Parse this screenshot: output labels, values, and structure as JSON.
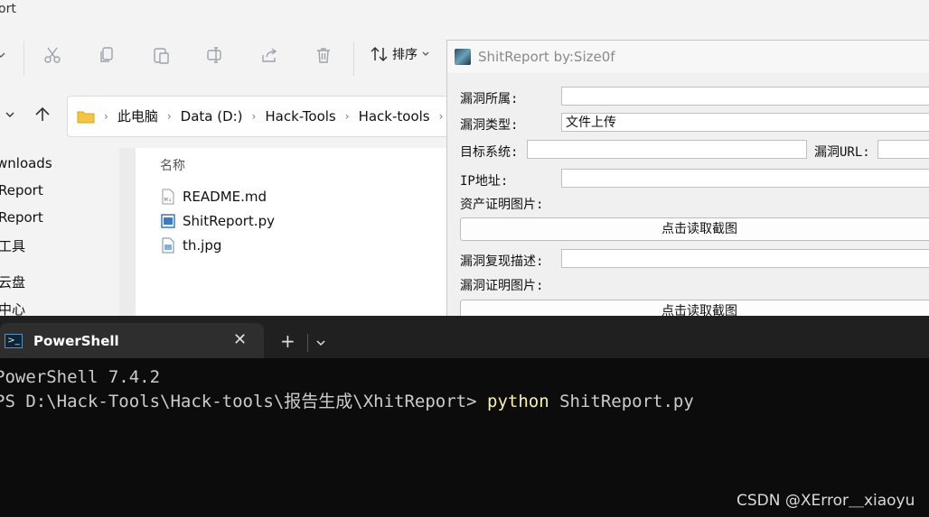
{
  "explorer": {
    "title_fragment": "ort",
    "toolbar": {
      "sort_label": "排序",
      "icons": [
        "cut-icon",
        "copy-icon",
        "paste-icon",
        "rename-icon",
        "share-icon",
        "delete-icon"
      ]
    },
    "breadcrumbs": [
      "此电脑",
      "Data (D:)",
      "Hack-Tools",
      "Hack-tools"
    ],
    "left_nav": [
      "wnloads",
      "Report",
      "Report",
      "工具",
      "云盘",
      "中心"
    ],
    "column_header": "名称",
    "files": [
      {
        "name": "README.md",
        "icon": "markdown-file-icon"
      },
      {
        "name": "ShitReport.py",
        "icon": "python-file-icon"
      },
      {
        "name": "th.jpg",
        "icon": "image-file-icon"
      }
    ]
  },
  "app": {
    "title": "ShitReport by:Size0f",
    "labels": {
      "vuln_owner": "漏洞所属:",
      "vuln_type": "漏洞类型:",
      "target_system": "目标系统:",
      "vuln_url": "漏洞URL:",
      "ip_address": "IP地址:",
      "asset_proof": "资产证明图片:",
      "repro_desc": "漏洞复现描述:",
      "vuln_proof": "漏洞证明图片:"
    },
    "values": {
      "vuln_type": "文件上传"
    },
    "buttons": {
      "read_screenshot_1": "点击读取截图",
      "read_screenshot_2": "点击读取截图"
    }
  },
  "terminal": {
    "tab_title": "PowerShell",
    "lines": {
      "version": "PowerShell 7.4.2",
      "prompt": "PS D:\\Hack-Tools\\Hack-tools\\报告生成\\XhitReport> ",
      "command": "python",
      "argument": " ShitReport.py"
    }
  },
  "watermark": "CSDN @XError＿xiaoyu",
  "colors": {
    "terminal_bg": "#0c0c0c",
    "command_yellow": "#f9f1a5",
    "explorer_bg": "#f3f3f3"
  }
}
